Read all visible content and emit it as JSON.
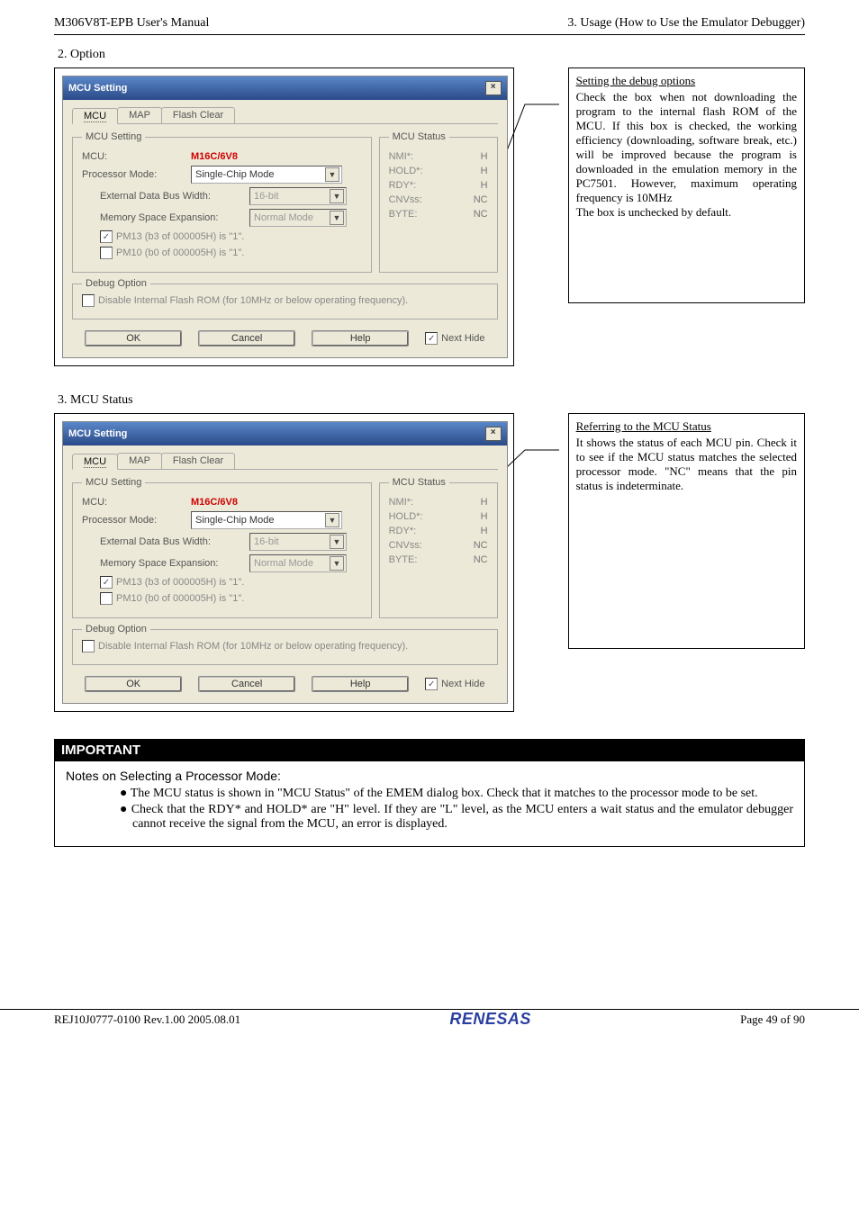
{
  "header": {
    "left": "M306V8T-EPB User's Manual",
    "right": "3. Usage (How to Use the Emulator Debugger)"
  },
  "option": {
    "section_title": "2. Option",
    "dialog_title": "MCU Setting",
    "tabs": {
      "mcu": "MCU",
      "map": "MAP",
      "flash": "Flash Clear"
    },
    "mcu_setting_legend": "MCU Setting",
    "mcu_label": "MCU:",
    "mcu_value": "M16C/6V8",
    "proc_label": "Processor Mode:",
    "proc_value": "Single-Chip Mode",
    "ext_bus_label": "External Data Bus Width:",
    "ext_bus_value": "16-bit",
    "mem_exp_label": "Memory Space Expansion:",
    "mem_exp_value": "Normal Mode",
    "pm13_label": "PM13 (b3 of 000005H) is \"1\".",
    "pm10_label": "PM10 (b0 of 000005H) is \"1\".",
    "status_legend": "MCU Status",
    "status": [
      {
        "pin": "NMI*:",
        "val": "H"
      },
      {
        "pin": "HOLD*:",
        "val": "H"
      },
      {
        "pin": "RDY*:",
        "val": "H"
      },
      {
        "pin": "CNVss:",
        "val": "NC"
      },
      {
        "pin": "BYTE:",
        "val": "NC"
      }
    ],
    "debug_legend": "Debug Option",
    "debug_checkbox": "Disable Internal Flash ROM (for 10MHz or below operating frequency).",
    "buttons": {
      "ok": "OK",
      "cancel": "Cancel",
      "help": "Help"
    },
    "next_hide": "Next Hide",
    "side": {
      "title": "Setting the debug options",
      "body": "Check the box when not downloading the program to the internal flash ROM of the MCU. If this box is checked, the working efficiency (downloading, software break, etc.) will be improved because the program is downloaded in the emulation memory in the PC7501. However, maximum operating frequency is 10MHz\nThe box is unchecked by default."
    }
  },
  "status_section": {
    "section_title": "3. MCU Status",
    "side": {
      "title": "Referring to the MCU Status",
      "body": "It shows the status of each MCU pin. Check it to see if the MCU status matches the selected processor mode. \"NC\" means that the pin status is indeterminate."
    }
  },
  "important": {
    "bar": "IMPORTANT",
    "title": "Notes on Selecting a Processor Mode:",
    "items": [
      "The MCU status is shown in \"MCU Status\" of the EMEM dialog box. Check that it matches to the processor mode to be set.",
      "Check that the RDY* and HOLD* are \"H\" level. If they are \"L\" level, as the MCU enters a wait status and the emulator debugger cannot receive the signal from the MCU, an error is displayed."
    ]
  },
  "footer": {
    "left": "REJ10J0777-0100   Rev.1.00   2005.08.01",
    "logo": "RENESAS",
    "right": "Page 49 of 90"
  }
}
